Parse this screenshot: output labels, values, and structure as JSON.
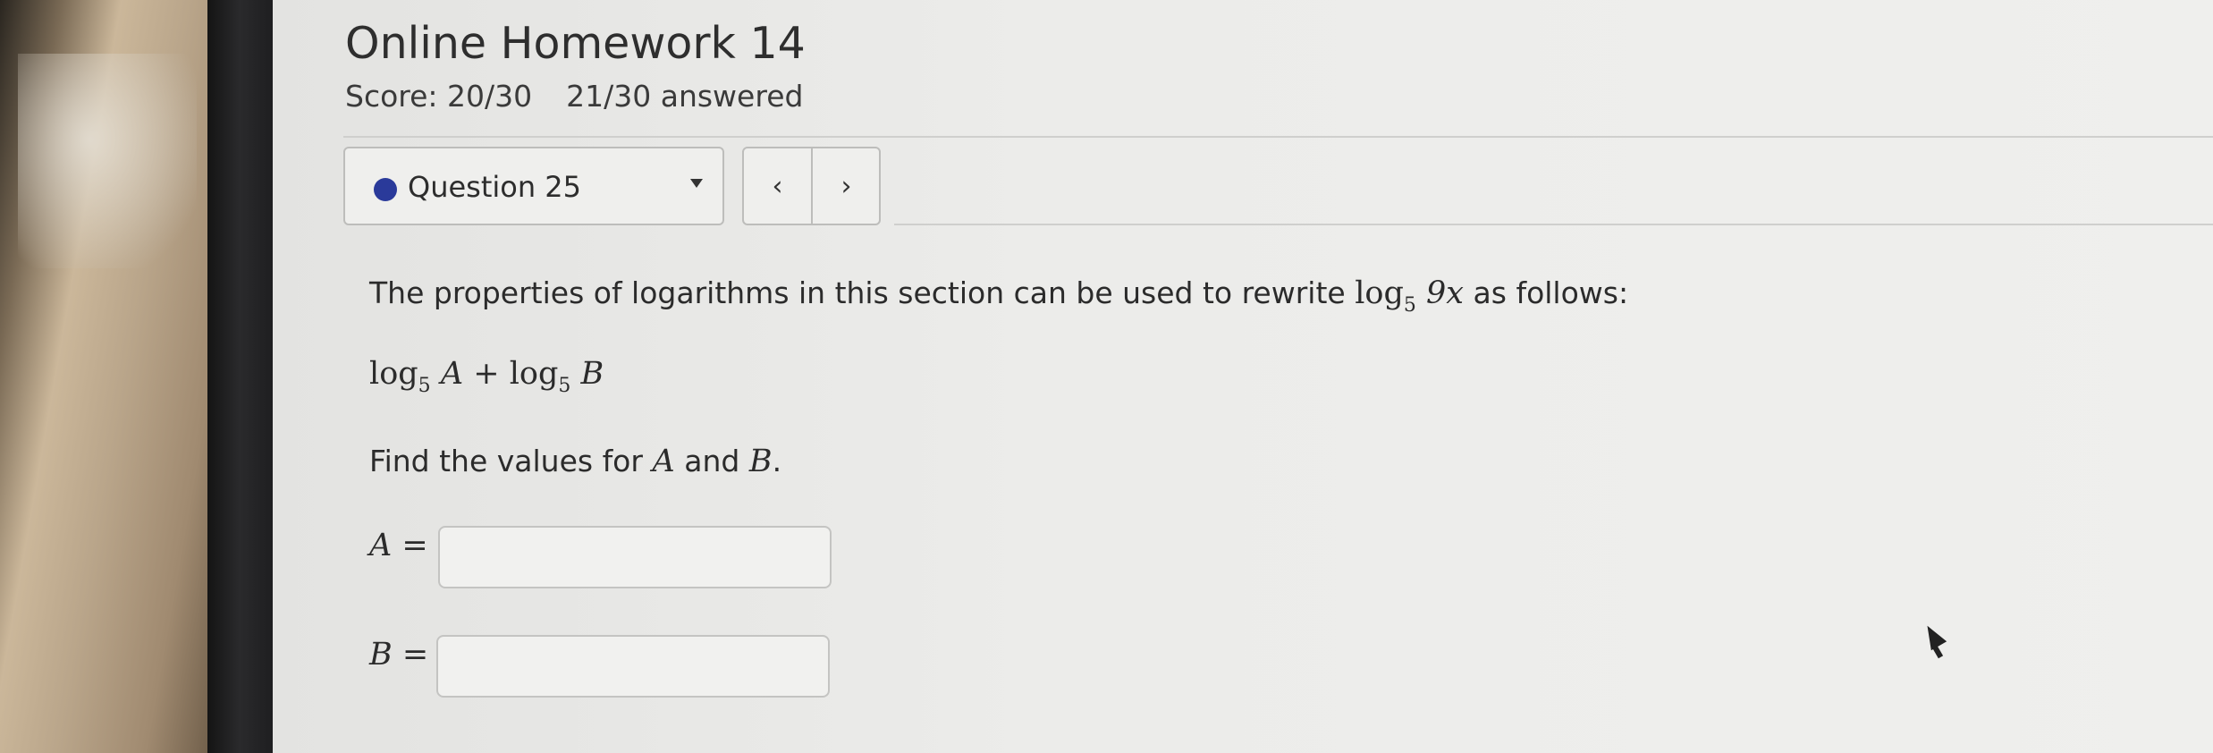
{
  "header": {
    "title": "Online Homework 14",
    "score": "Score: 20/30",
    "answered": "21/30 answered"
  },
  "question_nav": {
    "selected_question": "Question 25",
    "prev_symbol": "‹",
    "next_symbol": "›",
    "status_color": "#2a3a9a"
  },
  "problem": {
    "intro_before": "The properties of logarithms in this section can be used to rewrite",
    "log_word": "log",
    "base": "5",
    "argument": "9x",
    "intro_after": "as follows:",
    "expression": {
      "log1": "log",
      "base1": "5",
      "var1": "A",
      "plus": "+",
      "log2": "log",
      "base2": "5",
      "var2": "B"
    },
    "find_before": "Find the values for",
    "find_var_a": "A",
    "find_and": "and",
    "find_var_b": "B",
    "find_period": "."
  },
  "answers": {
    "a_var": "A",
    "a_equals": "=",
    "a_value": "",
    "b_var": "B",
    "b_equals": "=",
    "b_value": ""
  }
}
